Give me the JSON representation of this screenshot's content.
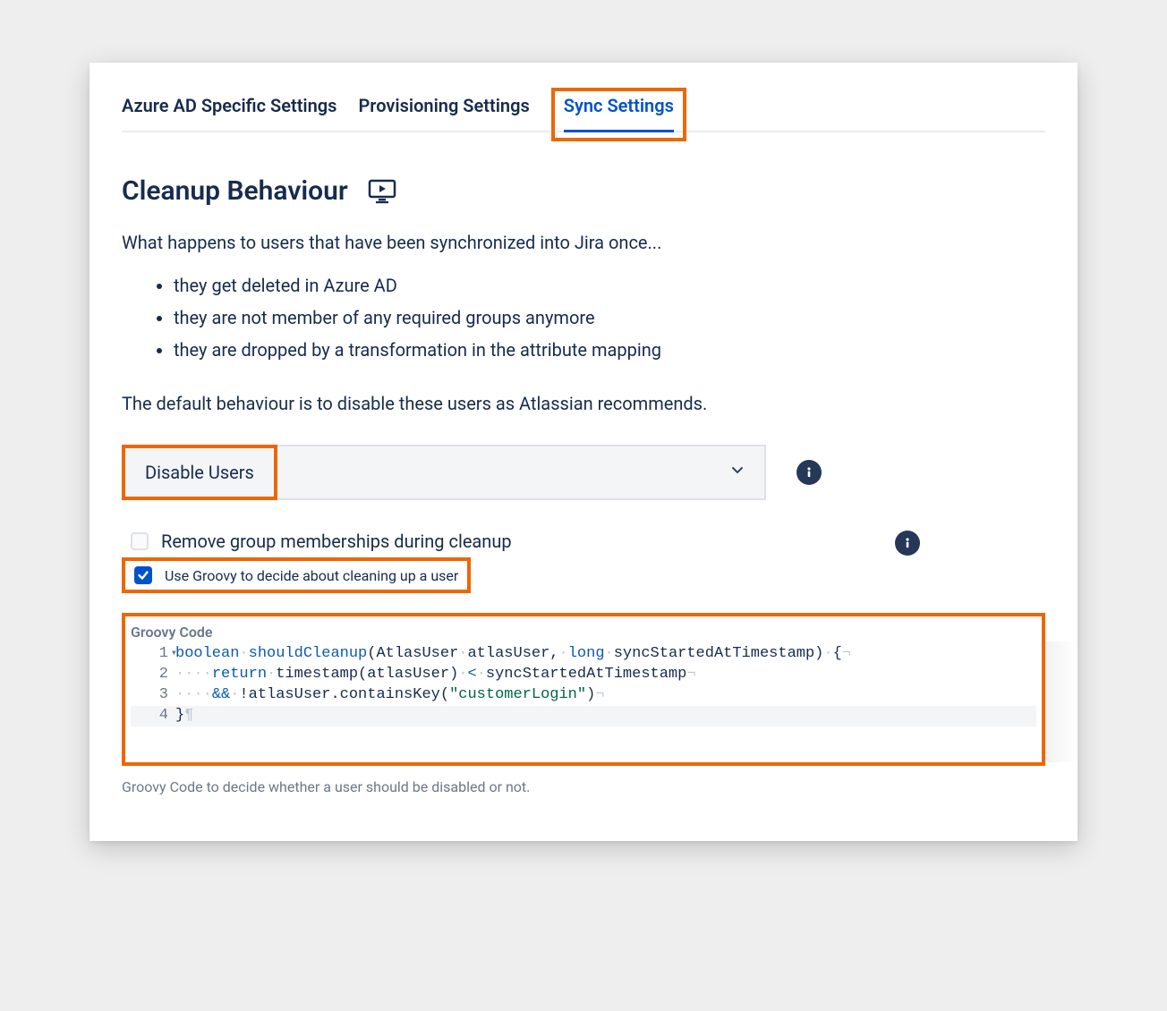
{
  "tabs": {
    "azure": "Azure AD Specific Settings",
    "provisioning": "Provisioning Settings",
    "sync": "Sync Settings"
  },
  "section": {
    "title": "Cleanup Behaviour",
    "intro": "What happens to users that have been synchronized into Jira once...",
    "bullets": [
      "they get deleted in Azure AD",
      "they are not member of any required groups anymore",
      "they are dropped by a transformation in the attribute mapping"
    ],
    "note": "The default behaviour is to disable these users as Atlassian recommends."
  },
  "select": {
    "label": "Disable Users"
  },
  "checkboxes": {
    "remove_groups": "Remove group memberships during cleanup",
    "use_groovy": "Use Groovy to decide about cleaning up a user"
  },
  "code": {
    "title": "Groovy Code",
    "help": "Groovy Code to decide whether a user should be disabled or not.",
    "lines": {
      "n1": "1",
      "n2": "2",
      "n3": "3",
      "n4": "4",
      "l1_kw1": "boolean",
      "l1_fn": "shouldCleanup",
      "l1_sig1": "(AtlasUser",
      "l1_sig2": "atlasUser,",
      "l1_kw2": "long",
      "l1_sig3": "syncStartedAtTimestamp)",
      "l1_brace": "{",
      "l2_kw": "return",
      "l2_rest": "timestamp(atlasUser)",
      "l2_op": "<",
      "l2_tail": "syncStartedAtTimestamp",
      "l3_op": "&&",
      "l3_rest": "!atlasUser.containsKey(",
      "l3_str": "\"customerLogin\"",
      "l3_close": ")",
      "l4": "}"
    }
  }
}
